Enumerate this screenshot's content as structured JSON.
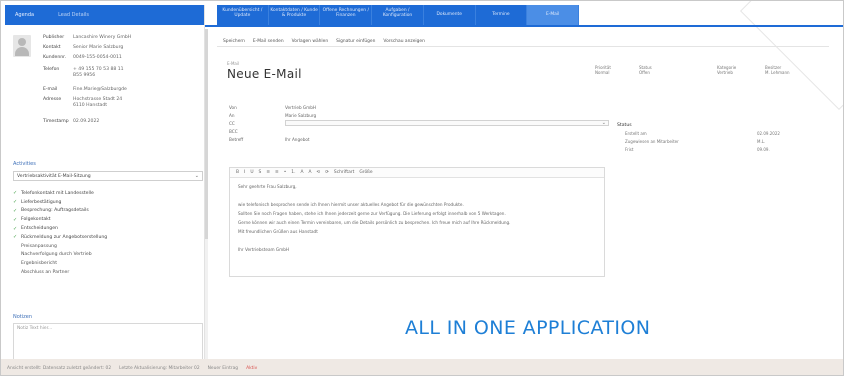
{
  "left_tabs": [
    "Agenda",
    "Lead Details"
  ],
  "contact": {
    "rows": [
      {
        "label": "Publisher",
        "value": "Lancashire Winery GmbH"
      },
      {
        "label": "Kontakt",
        "value": "Senior Marie Salzburg"
      },
      {
        "label": "Kundennr.",
        "value": "0049-155-0054-0011"
      },
      {
        "label": "Telefon",
        "value": "+ 49 155 70 53 88 11 B55 9956"
      },
      {
        "label": "E-mail",
        "value": "Fine.Marie@Salzburgde"
      },
      {
        "label": "Adresse",
        "value": "Hochstrasse Stadt 24 6110 Hanstadt"
      },
      {
        "label": "Timestamp",
        "value": "02.09.2022"
      }
    ]
  },
  "sections": {
    "activities": "Activities",
    "notes": "Notizen"
  },
  "activity_select": "Vertriebsaktivität E-Mail-Sitzung",
  "checklist": [
    {
      "label": "Telefonkontakt mit Landesstelle",
      "checked": true
    },
    {
      "label": "Lieferbestätigung",
      "checked": true
    },
    {
      "label": "Besprechung: Auftragsdetails",
      "checked": true
    },
    {
      "label": "Folgekontakt",
      "checked": true
    },
    {
      "label": "Entscheidungen",
      "checked": true
    },
    {
      "label": "Rückmeldung zur Angebotserstellung",
      "checked": true
    },
    {
      "label": "Preisanpassung",
      "checked": false
    },
    {
      "label": "Nachverfolgung durch Vertrieb",
      "checked": false
    },
    {
      "label": "Ergebnisbericht",
      "checked": false
    },
    {
      "label": "Abschluss an Partner",
      "checked": false
    }
  ],
  "notes_placeholder": "Notiz Text hier...",
  "nav": [
    {
      "label": "Kundenübersicht / Update",
      "active": false
    },
    {
      "label": "Kontaktdaten / Kunde & Produkte",
      "active": false
    },
    {
      "label": "Offene Rechnungen / Finanzen",
      "active": false
    },
    {
      "label": "Aufgaben / Konfiguration",
      "active": false
    },
    {
      "label": "Dokumente",
      "active": false
    },
    {
      "label": "Termine",
      "active": false
    },
    {
      "label": "E-Mail",
      "active": true
    }
  ],
  "toolbar": [
    "Speichern",
    "E-Mail senden",
    "Vorlagen wählen",
    "Signatur einfügen",
    "Vorschau anzeigen"
  ],
  "record": {
    "small_header": "E-Mail",
    "title": "Neue E-Mail",
    "header_fields": [
      {
        "label": "Priorität",
        "value": "Normal"
      },
      {
        "label": "Status",
        "value": "Offen"
      },
      {
        "label": "Kategorie",
        "value": "Vertrieb"
      },
      {
        "label": "Besitzer",
        "value": "M. Lehmann"
      }
    ]
  },
  "form": [
    {
      "label": "Von",
      "value": "Vertrieb GmbH"
    },
    {
      "label": "An",
      "value": "Marie Salzburg"
    },
    {
      "label": "CC",
      "value": "",
      "dropdown": true
    },
    {
      "label": "BCC",
      "value": ""
    },
    {
      "label": "Betreff",
      "value": "Ihr Angebot"
    }
  ],
  "sidebox": {
    "title": "Status",
    "rows": [
      {
        "label": "Erstellt am",
        "value": "02.09.2022"
      },
      {
        "label": "Zugewiesen an Mitarbeiter",
        "value": "M.L."
      },
      {
        "label": "Frist",
        "value": "09.09."
      }
    ]
  },
  "editor": {
    "tools": [
      "B",
      "I",
      "U",
      "S",
      "≡",
      "≡",
      "•",
      "1.",
      "A",
      "A",
      "⟲",
      "⟳",
      "Schriftart",
      "Größe"
    ],
    "lines": [
      "Sehr geehrte Frau Salzburg,",
      "",
      "wie telefonisch besprochen sende ich Ihnen hiermit unser aktuelles Angebot für die gewünschten Produkte.",
      "Sollten Sie noch Fragen haben, stehe ich Ihnen jederzeit gerne zur Verfügung. Die Lieferung erfolgt innerhalb von 5 Werktagen.",
      "Gerne können wir auch einen Termin vereinbaren, um die Details persönlich zu besprechen. Ich freue mich auf Ihre Rückmeldung.",
      "Mit freundlichen Grüßen aus Hanstadt",
      "",
      "Ihr Vertriebsteam GmbH"
    ]
  },
  "statusbar": {
    "left": "Ansicht erstellt: Datensatz zuletzt geändert: 02",
    "mid": "Letzte Aktualisierung: Mitarbeiter 02",
    "right_label": "Neuer Eintrag",
    "right_value": "Aktiv"
  },
  "brand": "ALL IN ONE APPLICATION",
  "colors": {
    "accent": "#1e6bd6",
    "brand_text": "#1e7fd6",
    "check": "#43a047",
    "alert": "#d9534f"
  }
}
